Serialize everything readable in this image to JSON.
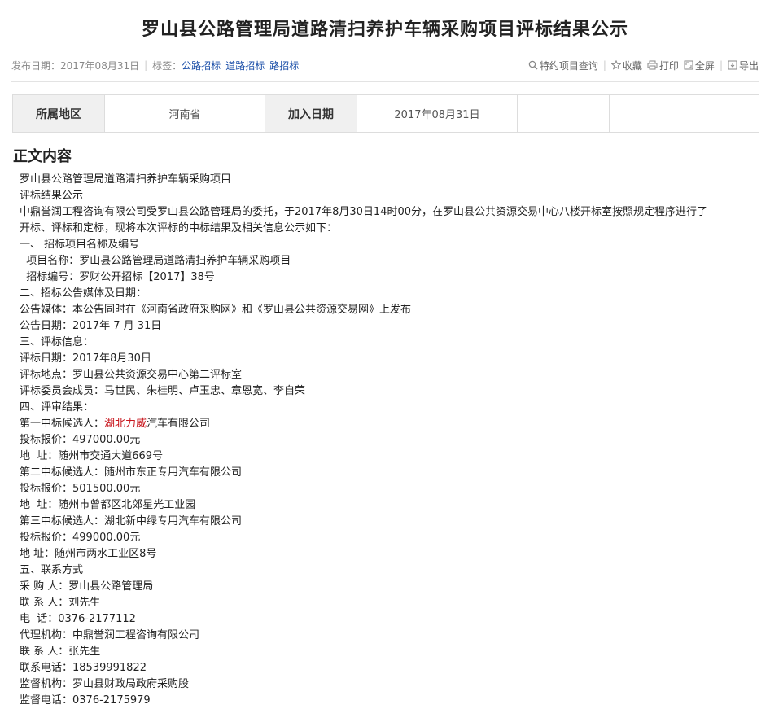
{
  "title": "罗山县公路管理局道路清扫养护车辆采购项目评标结果公示",
  "meta": {
    "publish_label": "发布日期：",
    "publish_date": "2017年08月31日",
    "tags_label": "标签：",
    "tags": [
      "公路招标",
      "道路招标",
      "路招标"
    ],
    "tools": {
      "query": "特约项目查询",
      "favorite": "收藏",
      "print": "打印",
      "fullscreen": "全屏",
      "export": "导出"
    }
  },
  "info": {
    "region_label": "所属地区",
    "region_value": "河南省",
    "date_label": "加入日期",
    "date_value": "2017年08月31日"
  },
  "section_title": "正文内容",
  "content": {
    "l1": "罗山县公路管理局道路清扫养护车辆采购项目",
    "l2": "评标结果公示",
    "l3": "中鼎誉润工程咨询有限公司受罗山县公路管理局的委托，于2017年8月30日14时00分，在罗山县公共资源交易中心八楼开标室按照规定程序进行了",
    "l4": "开标、评标和定标，现将本次评标的中标结果及相关信息公示如下：",
    "l5": "一、 招标项目名称及编号",
    "l6": "  项目名称：罗山县公路管理局道路清扫养护车辆采购项目",
    "l7": "  招标编号：罗财公开招标【2017】38号",
    "l8": "二、招标公告媒体及日期：",
    "l9": "公告媒体：本公告同时在《河南省政府采购网》和《罗山县公共资源交易网》上发布",
    "l10": "公告日期：2017年 7 月 31日",
    "l11": "三、评标信息：",
    "l12": "评标日期：2017年8月30日",
    "l13": "评标地点：罗山县公共资源交易中心第二评标室",
    "l14": "评标委员会成员：马世民、朱桂明、卢玉忠、章恩宽、李自荣",
    "l15": "四、评审结果：",
    "l16_pre": "第一中标候选人：",
    "l16_red": "湖北力威",
    "l16_post": "汽车有限公司",
    "l17": "投标报价：497000.00元",
    "l18": "地  址：随州市交通大道669号",
    "l19": "第二中标候选人：随州市东正专用汽车有限公司",
    "l20": "投标报价：501500.00元",
    "l21": "地  址：随州市曾都区北郊星光工业园",
    "l22": "第三中标候选人：湖北新中绿专用汽车有限公司",
    "l23": "投标报价：499000.00元",
    "l24": "地 址：随州市两水工业区8号",
    "l25": "五、联系方式",
    "l26": "采 购 人：罗山县公路管理局",
    "l27": "联 系 人：刘先生",
    "l28": "电  话：0376-2177112",
    "l29": "代理机构：中鼎誉润工程咨询有限公司",
    "l30": "联 系 人：张先生",
    "l31": "联系电话：18539991822",
    "l32": "监督机构：罗山县财政局政府采购股",
    "l33": "监督电话：0376-2175979"
  },
  "colors": {
    "tag_link": "#1a4ea8",
    "highlight": "#c8161d",
    "table_header_bg": "#f0f0f0"
  }
}
